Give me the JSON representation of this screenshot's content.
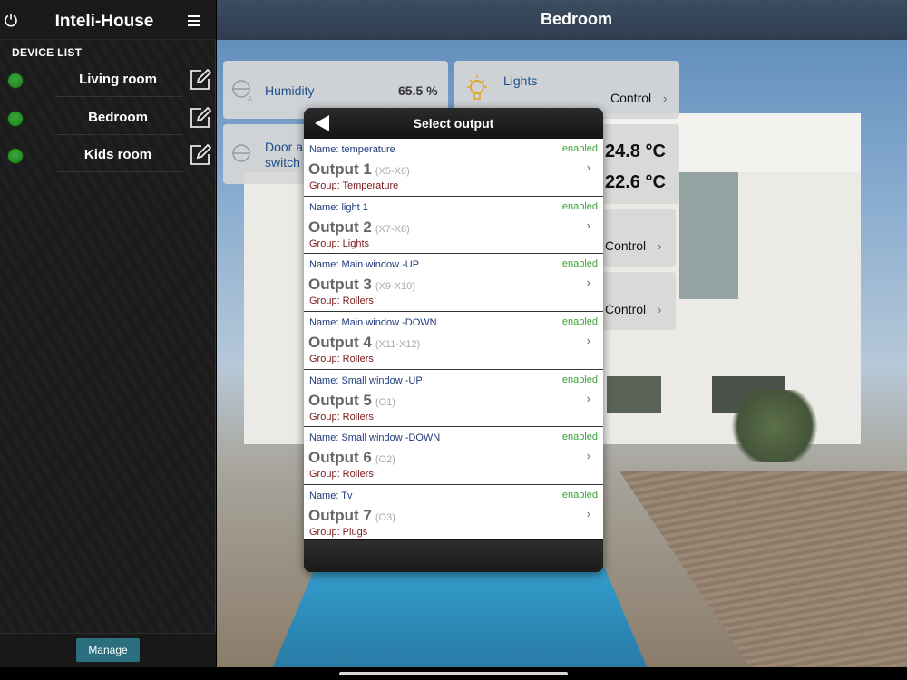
{
  "sidebar": {
    "app_title": "Inteli-House",
    "device_list_label": "DEVICE LIST",
    "devices": [
      {
        "name": "Living room",
        "status_color": "#2e9b2e"
      },
      {
        "name": "Bedroom",
        "status_color": "#2e9b2e"
      },
      {
        "name": "Kids room",
        "status_color": "#2e9b2e"
      }
    ],
    "manage_label": "Manage"
  },
  "main": {
    "room_title": "Bedroom",
    "tiles": {
      "humidity": {
        "label": "Humidity",
        "value": "65.5 %"
      },
      "lights": {
        "label": "Lights",
        "control": "Control"
      },
      "door": {
        "label_line1": "Door al",
        "label_line2": "switch"
      },
      "temp1": "24.8 °C",
      "temp2": "22.6 °C",
      "control2": "Control",
      "control3": "Control"
    }
  },
  "modal": {
    "title": "Select output",
    "chevron": "›",
    "outputs": [
      {
        "name": "Name: temperature",
        "status": "enabled",
        "title": "Output 1",
        "pins": "(X5-X6)",
        "group": "Group: Temperature"
      },
      {
        "name": "Name: light 1",
        "status": "enabled",
        "title": "Output 2",
        "pins": "(X7-X8)",
        "group": "Group: Lights"
      },
      {
        "name": "Name: Main window -UP",
        "status": "enabled",
        "title": "Output 3",
        "pins": "(X9-X10)",
        "group": "Group: Rollers"
      },
      {
        "name": "Name: Main window -DOWN",
        "status": "enabled",
        "title": "Output 4",
        "pins": "(X11-X12)",
        "group": "Group: Rollers"
      },
      {
        "name": "Name: Small window -UP",
        "status": "enabled",
        "title": "Output 5",
        "pins": "(O1)",
        "group": "Group: Rollers"
      },
      {
        "name": "Name: Small window -DOWN",
        "status": "enabled",
        "title": "Output 6",
        "pins": "(O2)",
        "group": "Group: Rollers"
      },
      {
        "name": "Name: Tv",
        "status": "enabled",
        "title": "Output 7",
        "pins": "(O3)",
        "group": "Group: Plugs"
      }
    ]
  },
  "colors": {
    "accent": "#2a6f7f",
    "enabled": "#3aa03a",
    "name_text": "#1d3a7a",
    "group_text": "#7a1a1a"
  }
}
